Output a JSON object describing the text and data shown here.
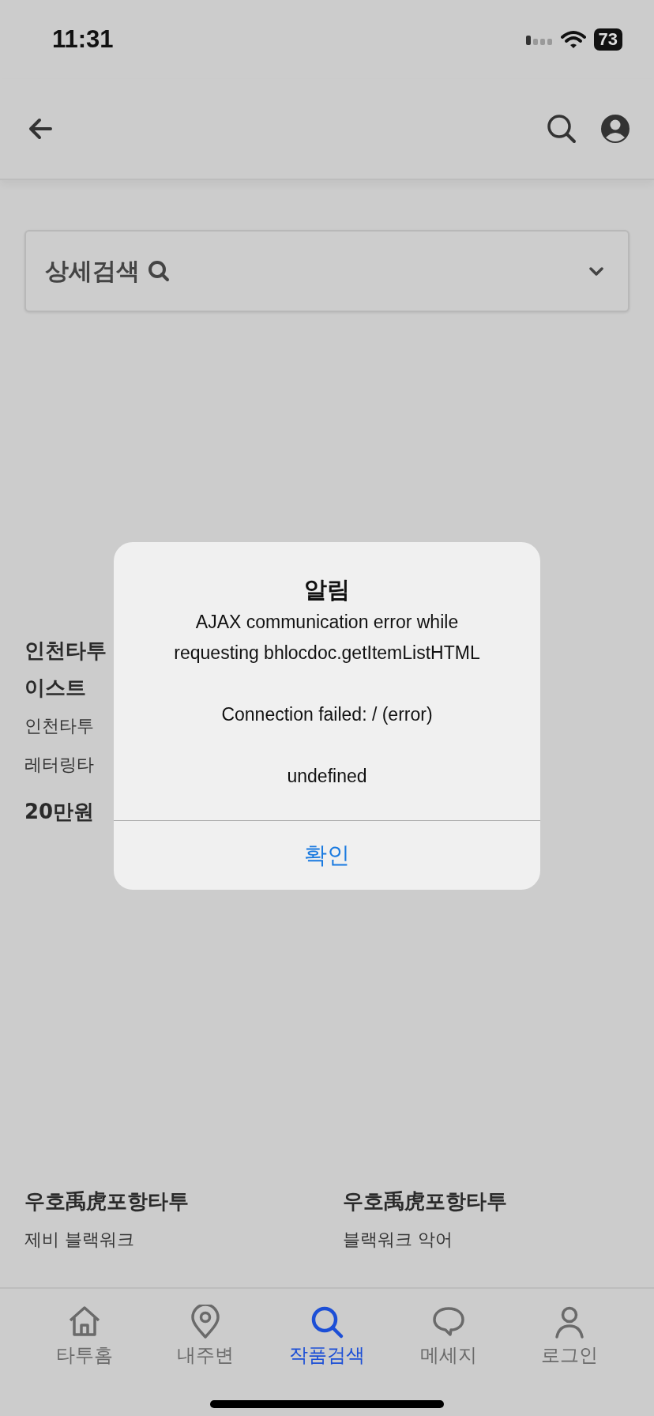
{
  "status_bar": {
    "time": "11:31",
    "battery": "73"
  },
  "search_panel": {
    "label": "상세검색",
    "expanded": false
  },
  "listing_rows": [
    {
      "cards": [
        {
          "title_lines": [
            "인천타투",
            "이스트"
          ],
          "description_lines": [
            "인천타투",
            "레터링타"
          ],
          "price": "20만원"
        }
      ]
    },
    {
      "cards": [
        {
          "title_lines": [
            "우호禹虎포항타투"
          ],
          "description_lines": [
            "제비 블랙워크"
          ]
        },
        {
          "title_lines": [
            "우호禹虎포항타투"
          ],
          "description_lines": [
            "블랙워크 악어"
          ]
        }
      ]
    }
  ],
  "dialog": {
    "title": "알림",
    "paragraphs": [
      "AJAX communication error while requesting bhlocdoc.getItemListHTML",
      "Connection failed: / (error)",
      "undefined"
    ],
    "button": "확인"
  },
  "tabs": [
    {
      "label": "타투홈",
      "selected": false
    },
    {
      "label": "내주변",
      "selected": false
    },
    {
      "label": "작품검색",
      "selected": true
    },
    {
      "label": "메세지",
      "selected": false
    },
    {
      "label": "로그인",
      "selected": false
    }
  ]
}
